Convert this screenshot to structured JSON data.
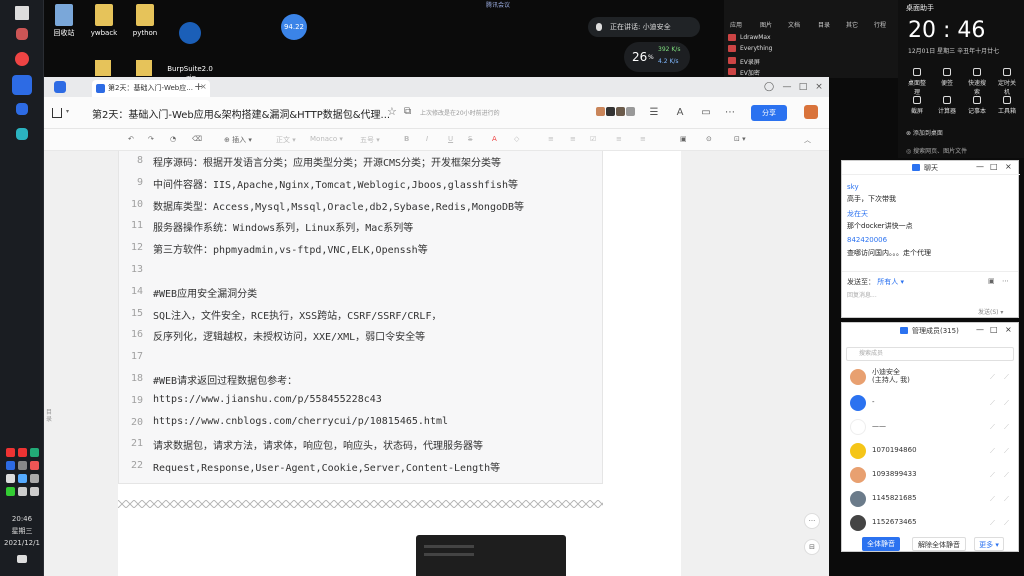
{
  "desktop": {
    "icons": [
      {
        "label": "回收站",
        "color": "#7aa7d9"
      },
      {
        "label": "ywback",
        "color": "#e6c35a"
      },
      {
        "label": "python",
        "color": "#e6c35a"
      },
      {
        "label": "BurpSuite2.0\n.zip",
        "color": "#1b5fb8"
      }
    ],
    "weather_bubble": "94.22",
    "top_status": "腾讯会议",
    "meeting_bar": "正在讲话: 小迪安全",
    "net_speed": {
      "value": "26",
      "unit": "%",
      "up": "392 K/s",
      "down": "4.2 K/s"
    }
  },
  "taskbar": {
    "icons": [
      "windows-icon",
      "chrome-icon",
      "tencent-docs-icon",
      "app-icon",
      "app-icon-2"
    ],
    "clock": [
      "20:46",
      "星期三",
      "2021/12/1"
    ]
  },
  "right_top_panel": {
    "tabs": [
      "应用",
      "图片",
      "文档",
      "目录",
      "其它",
      "行程"
    ],
    "items": [
      "LdrawMax",
      "Everything",
      "EV录屏",
      "EV加密"
    ]
  },
  "control_center": {
    "title": "桌面助手",
    "time": "20 : 46",
    "date": "12月01日 星期三 辛丑年十月廿七",
    "buttons_row1": [
      "桌面整理",
      "便签",
      "快速搜索",
      "定时关机"
    ],
    "buttons_row2": [
      "截屏",
      "计算器",
      "记事本",
      "工具箱"
    ],
    "link": "⊗ 添加到桌面",
    "search": "◎ 搜索网页、图片文件"
  },
  "browser": {
    "tab_title": "第2天：基础入门-Web应...",
    "tab_close": "×",
    "new_tab": "+",
    "window_buttons": [
      "◯",
      "—",
      "□",
      "×"
    ],
    "doc_title": "第2天：基础入门-Web应用&架构搭建&漏洞&HTTP数据包&代理...",
    "save_status": "上次修改是在20小时前进行的",
    "share_label": "分享"
  },
  "toolbar": {
    "undo": "↶",
    "redo": "↷",
    "format_brush": "⌫",
    "clear": "◇",
    "insert": "⊕ 插入 ▾",
    "style": "正文 ▾",
    "font": "Monaco ▾",
    "size": "五号 ▾",
    "bold": "B",
    "italic": "I",
    "underline": "U",
    "strike": "S",
    "font_color": "A",
    "highlight": "◔",
    "list1": "≡",
    "list2": "≡",
    "checklist": "☑",
    "align": "≡",
    "indent": "≡",
    "image": "▣",
    "link": "⊙",
    "more": "⊡ ▾",
    "collapse": "︿"
  },
  "code_lines": [
    {
      "n": "8",
      "text": "程序源码：根据开发语言分类；应用类型分类；开源CMS分类；开发框架分类等"
    },
    {
      "n": "9",
      "text": "中间件容器：IIS,Apache,Nginx,Tomcat,Weblogic,Jboos,glasshfish等"
    },
    {
      "n": "10",
      "text": "数据库类型：Access,Mysql,Mssql,Oracle,db2,Sybase,Redis,MongoDB等"
    },
    {
      "n": "11",
      "text": "服务器操作系统：Windows系列，Linux系列，Mac系列等"
    },
    {
      "n": "12",
      "text": "第三方软件：phpmyadmin,vs-ftpd,VNC,ELK,Openssh等"
    },
    {
      "n": "13",
      "text": ""
    },
    {
      "n": "14",
      "text": "#WEB应用安全漏洞分类"
    },
    {
      "n": "15",
      "text": "SQL注入，文件安全，RCE执行，XSS跨站，CSRF/SSRF/CRLF，"
    },
    {
      "n": "16",
      "text": "反序列化，逻辑越权，未授权访问，XXE/XML，弱口令安全等"
    },
    {
      "n": "17",
      "text": ""
    },
    {
      "n": "18",
      "text": "#WEB请求返回过程数据包参考："
    },
    {
      "n": "19",
      "text": "https://www.jianshu.com/p/558455228c43"
    },
    {
      "n": "20",
      "text": "https://www.cnblogs.com/cherrycui/p/10815465.html"
    },
    {
      "n": "21",
      "text": "请求数据包，请求方法，请求体，响应包，响应头，状态码，代理服务器等"
    },
    {
      "n": "22",
      "text": "Request,Response,User-Agent,Cookie,Server,Content-Length等"
    }
  ],
  "side_toggle": "目录",
  "float_buttons": [
    "···",
    "⊟"
  ],
  "chat": {
    "title": "聊天",
    "messages": [
      {
        "name": "sky",
        "text": "高手，下次带我"
      },
      {
        "name": "龙在天",
        "text": "那个docker讲快一点"
      },
      {
        "name": "842420006",
        "text": "查哪访问国内。。。走个代理"
      }
    ],
    "send_to_label": "发送至：",
    "send_to_value": "所有人 ▾",
    "input_placeholder": "回复消息...",
    "send_label": "发送(S) ▾"
  },
  "members": {
    "title": "管理成员(315)",
    "search_placeholder": "搜索成员",
    "rows": [
      {
        "name": "小迪安全\n(主持人, 我)",
        "color": "#e8a070"
      },
      {
        "name": "-",
        "color": "#2b72f0"
      },
      {
        "name": "——",
        "color": "#ffffff"
      },
      {
        "name": "1070194860",
        "color": "#f5c518"
      },
      {
        "name": "1093899433",
        "color": "#e8a070"
      },
      {
        "name": "1145821685",
        "color": "#6b7b8a"
      },
      {
        "name": "1152673465",
        "color": "#444"
      }
    ],
    "mute_all": "全体静音",
    "unmute_all": "解除全体静音",
    "more": "更多 ▾"
  }
}
